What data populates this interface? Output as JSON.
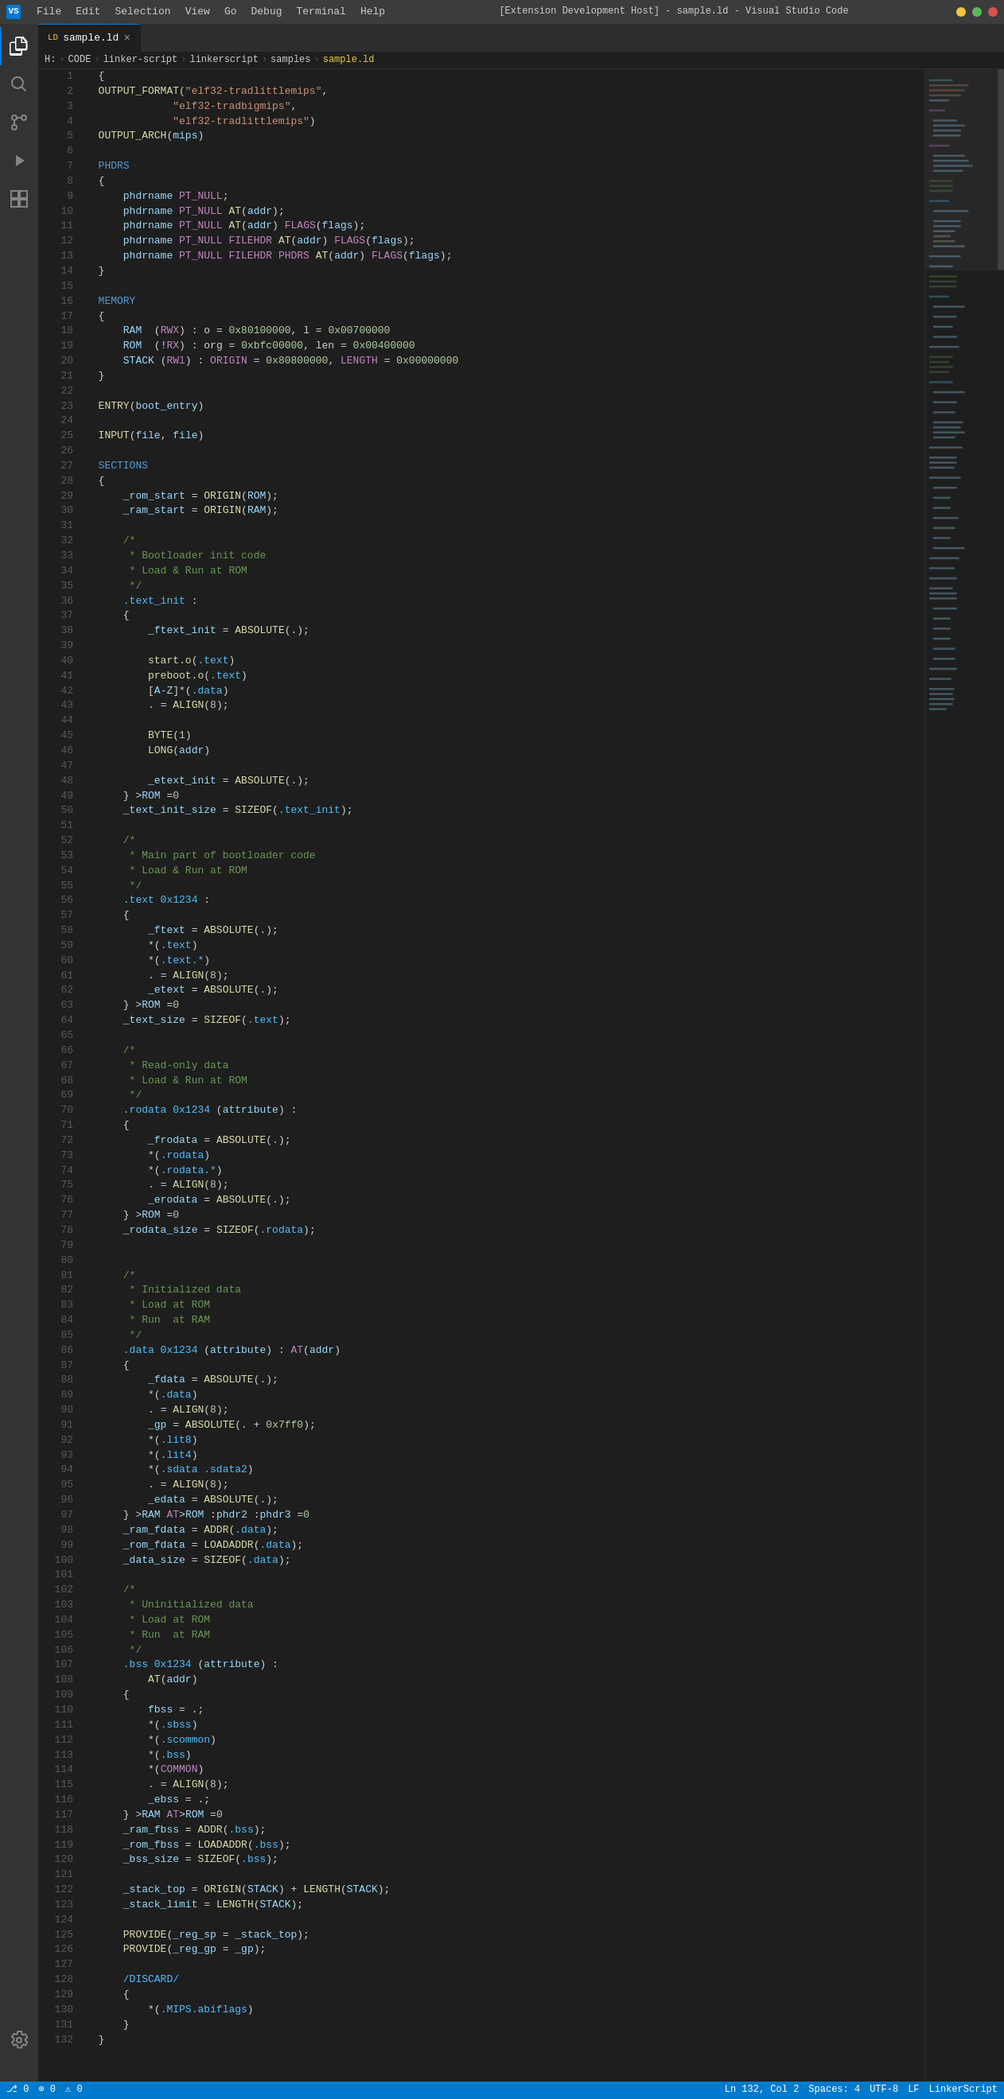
{
  "titlebar": {
    "title": "[Extension Development Host] - sample.ld - Visual Studio Code",
    "menus": [
      "File",
      "Edit",
      "Selection",
      "View",
      "Go",
      "Debug",
      "Terminal",
      "Help"
    ]
  },
  "tabs": [
    {
      "label": "sample.ld",
      "active": true,
      "icon": "ld-file"
    }
  ],
  "breadcrumb": {
    "parts": [
      "H:",
      "CODE",
      "linker-script",
      "linkerscript",
      "samples",
      "sample.ld"
    ]
  },
  "statusbar": {
    "left": {
      "git": "⎇ 0",
      "errors": "⊗ 0",
      "warnings": "⚠ 0"
    },
    "right": {
      "position": "Ln 132, Col 2",
      "spaces": "Spaces: 4",
      "encoding": "UTF-8",
      "lineending": "LF",
      "language": "LinkerScript"
    }
  },
  "code": {
    "lines": 132
  }
}
